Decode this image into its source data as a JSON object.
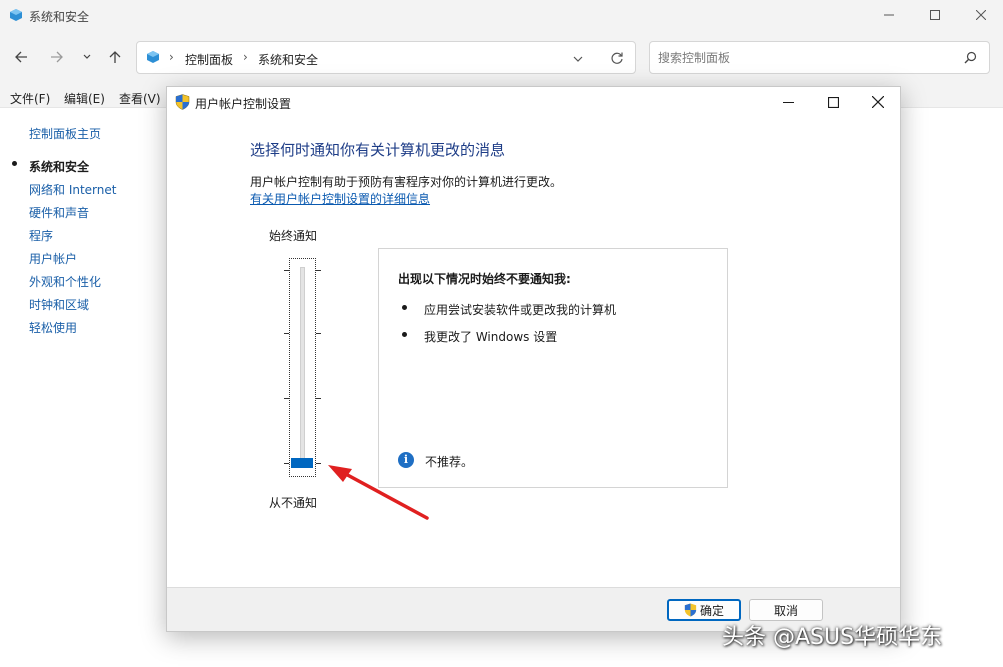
{
  "window": {
    "title": "系统和安全"
  },
  "address": {
    "root_segment": "控制面板",
    "current_segment": "系统和安全"
  },
  "search": {
    "placeholder": "搜索控制面板"
  },
  "menu": {
    "file": "文件(F)",
    "edit": "编辑(E)",
    "view": "查看(V)"
  },
  "sidebar": {
    "items": [
      {
        "label": "控制面板主页"
      },
      {
        "label": "系统和安全"
      },
      {
        "label": "网络和 Internet"
      },
      {
        "label": "硬件和声音"
      },
      {
        "label": "程序"
      },
      {
        "label": "用户帐户"
      },
      {
        "label": "外观和个性化"
      },
      {
        "label": "时钟和区域"
      },
      {
        "label": "轻松使用"
      }
    ],
    "active_index": 1
  },
  "dialog": {
    "title": "用户帐户控制设置",
    "heading": "选择何时通知你有关计算机更改的消息",
    "description": "用户帐户控制有助于预防有害程序对你的计算机进行更改。",
    "more_link": "有关用户帐户控制设置的详细信息",
    "slider": {
      "top_label": "始终通知",
      "bottom_label": "从不通知",
      "level": 0,
      "levels": 4
    },
    "info": {
      "title": "出现以下情况时始终不要通知我:",
      "items": [
        "应用尝试安装软件或更改我的计算机",
        "我更改了 Windows 设置"
      ],
      "note": "不推荐。"
    },
    "ok_label": "确定",
    "cancel_label": "取消"
  },
  "colors": {
    "accent": "#0067c0",
    "heading": "#1e3d87",
    "link": "#0b5ab0",
    "arrow": "#e02020"
  },
  "watermark": "头条 @ASUS华硕华东"
}
